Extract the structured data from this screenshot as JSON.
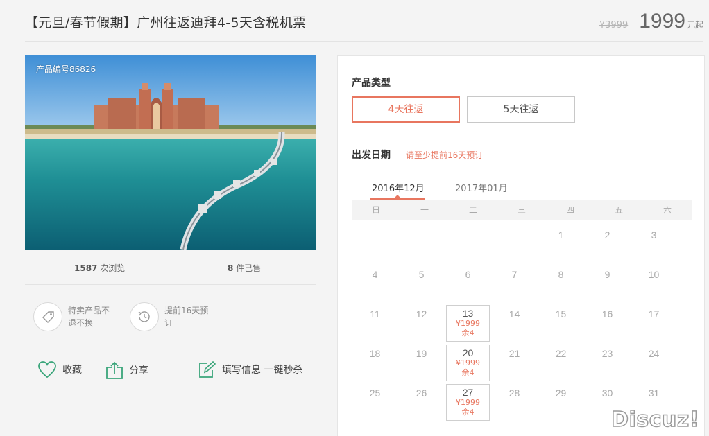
{
  "header": {
    "title": "【元旦/春节假期】广州往返迪拜4-5天含税机票",
    "old_price": "¥3999",
    "price": "1999",
    "price_unit": "元起"
  },
  "product": {
    "code_label": "产品编号86826",
    "views_count": "1587",
    "views_label": "次浏览",
    "sold_count": "8",
    "sold_label": "件已售"
  },
  "features": [
    {
      "icon": "tag-icon",
      "text": "特卖产品不退不换"
    },
    {
      "icon": "clock-icon",
      "text": "提前16天预订"
    }
  ],
  "actions": [
    {
      "icon": "heart-icon",
      "label": "收藏"
    },
    {
      "icon": "share-icon",
      "label": "分享"
    },
    {
      "icon": "edit-icon",
      "label": "填写信息 一键秒杀"
    }
  ],
  "booking": {
    "type_label": "产品类型",
    "types": [
      "4天往返",
      "5天往返"
    ],
    "date_label": "出发日期",
    "date_note": "请至少提前16天预订",
    "months": [
      "2016年12月",
      "2017年01月"
    ],
    "weekdays": [
      "日",
      "一",
      "二",
      "三",
      "四",
      "五",
      "六"
    ],
    "weeks": [
      [
        {
          "d": ""
        },
        {
          "d": ""
        },
        {
          "d": ""
        },
        {
          "d": ""
        },
        {
          "d": "1"
        },
        {
          "d": "2"
        },
        {
          "d": "3"
        }
      ],
      [
        {
          "d": "4"
        },
        {
          "d": "5"
        },
        {
          "d": "6"
        },
        {
          "d": "7"
        },
        {
          "d": "8"
        },
        {
          "d": "9"
        },
        {
          "d": "10"
        }
      ],
      [
        {
          "d": "11"
        },
        {
          "d": "12"
        },
        {
          "d": "13",
          "price": "¥1999",
          "left": "余4"
        },
        {
          "d": "14"
        },
        {
          "d": "15"
        },
        {
          "d": "16"
        },
        {
          "d": "17"
        }
      ],
      [
        {
          "d": "18"
        },
        {
          "d": "19"
        },
        {
          "d": "20",
          "price": "¥1999",
          "left": "余4"
        },
        {
          "d": "21"
        },
        {
          "d": "22"
        },
        {
          "d": "23"
        },
        {
          "d": "24"
        }
      ],
      [
        {
          "d": "25"
        },
        {
          "d": "26"
        },
        {
          "d": "27",
          "price": "¥1999",
          "left": "余4"
        },
        {
          "d": "28"
        },
        {
          "d": "29"
        },
        {
          "d": "30"
        },
        {
          "d": "31"
        }
      ]
    ]
  },
  "watermark": "Discuz!",
  "colors": {
    "accent": "#e8765f",
    "icon_green": "#3aa57a"
  }
}
